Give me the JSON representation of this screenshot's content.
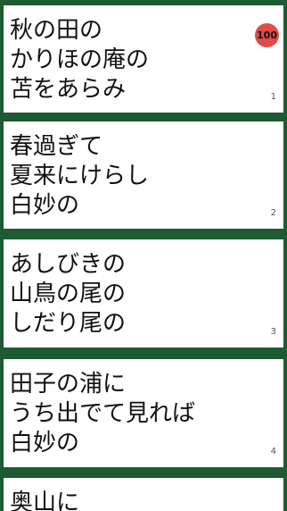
{
  "badge": {
    "value": "100",
    "color": "#e24a46"
  },
  "background_color": "#1e5a32",
  "cards": [
    {
      "number": "1",
      "lines": [
        "秋の田の",
        "かりほの庵の",
        "苫をあらみ"
      ]
    },
    {
      "number": "2",
      "lines": [
        "春過ぎて",
        "夏来にけらし",
        "白妙の"
      ]
    },
    {
      "number": "3",
      "lines": [
        "あしびきの",
        "山鳥の尾の",
        "しだり尾の"
      ]
    },
    {
      "number": "4",
      "lines": [
        "田子の浦に",
        "うち出でて見れば",
        "白妙の"
      ]
    },
    {
      "number": "",
      "lines": [
        "奥山に"
      ]
    }
  ]
}
